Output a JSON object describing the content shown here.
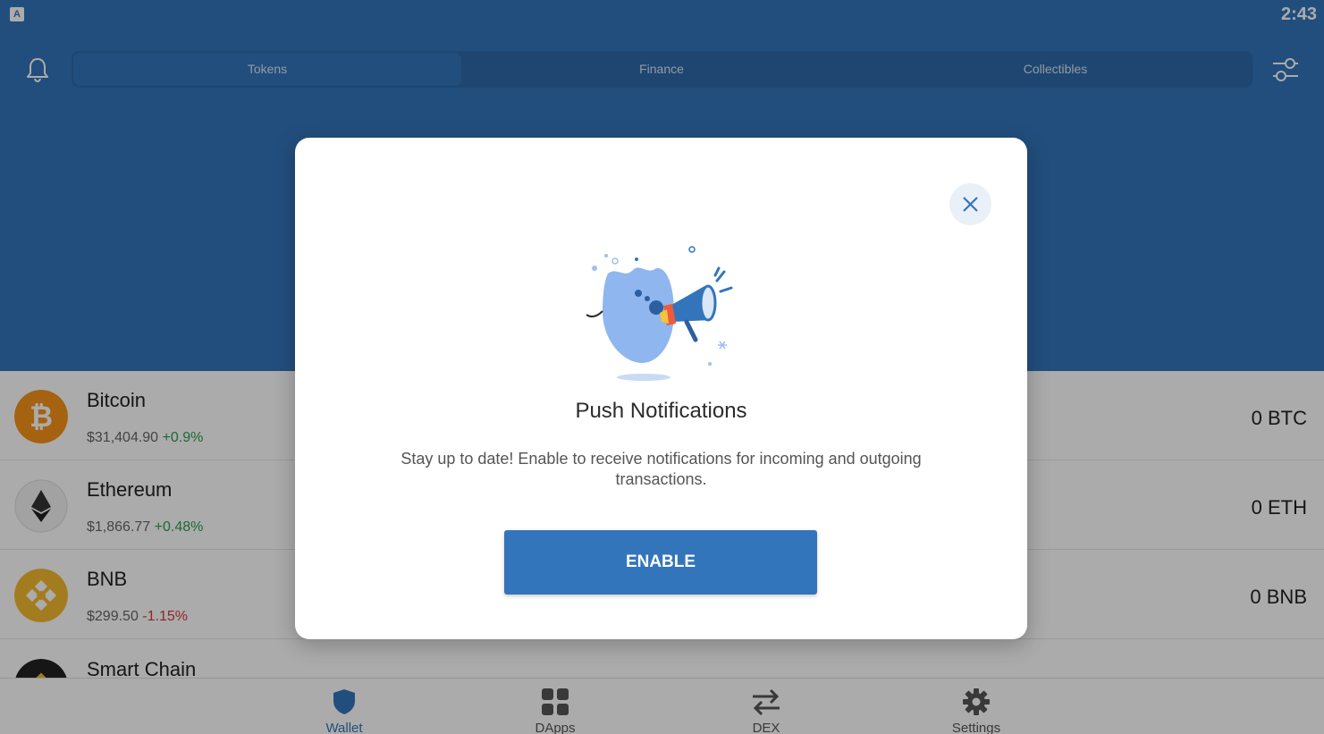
{
  "status_bar": {
    "time": "2:43",
    "app_icon_letter": "A"
  },
  "tabs": [
    {
      "label": "Tokens",
      "active": true
    },
    {
      "label": "Finance",
      "active": false
    },
    {
      "label": "Collectibles",
      "active": false
    }
  ],
  "tokens": [
    {
      "name": "Bitcoin",
      "price": "$31,404.90",
      "change": "+0.9%",
      "balance": "0 BTC",
      "icon": "bitcoin-icon",
      "color": "#f7931a"
    },
    {
      "name": "Ethereum",
      "price": "$1,866.77",
      "change": "+0.48%",
      "balance": "0 ETH",
      "icon": "ethereum-icon",
      "color": "#3c3c3d"
    },
    {
      "name": "BNB",
      "price": "$299.50",
      "change": "-1.15%",
      "balance": "0 BNB",
      "icon": "bnb-icon",
      "color": "#f3ba2f"
    },
    {
      "name": "Smart Chain",
      "price": "",
      "change": "",
      "balance": "",
      "icon": "smart-chain-icon",
      "color": "#f3ba2f"
    }
  ],
  "bottom_nav": [
    {
      "label": "Wallet",
      "icon": "shield-icon",
      "active": true
    },
    {
      "label": "DApps",
      "icon": "grid-icon",
      "active": false
    },
    {
      "label": "DEX",
      "icon": "swap-arrows-icon",
      "active": false
    },
    {
      "label": "Settings",
      "icon": "gear-icon",
      "active": false
    }
  ],
  "modal": {
    "title": "Push Notifications",
    "description": "Stay up to date! Enable to receive notifications for incoming and outgoing transactions.",
    "enable_label": "ENABLE",
    "close_icon": "close-icon",
    "illustration": "megaphone-mascot-illustration"
  },
  "colors": {
    "brand_blue": "#3375bb",
    "positive": "#2a9d4f",
    "negative": "#d93838"
  }
}
